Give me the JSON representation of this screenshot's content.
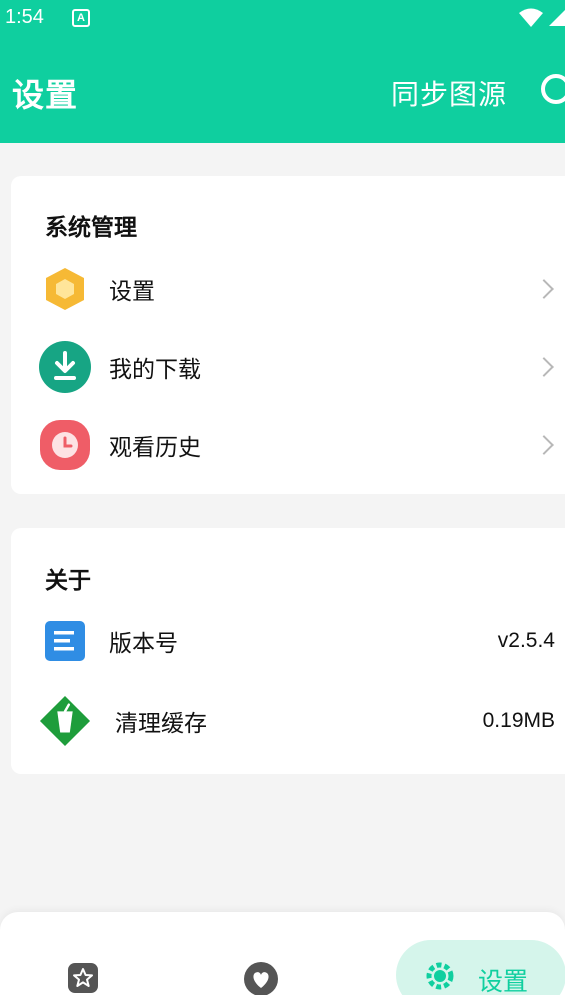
{
  "status": {
    "time": "1:54",
    "badge": "A"
  },
  "header": {
    "title": "设置",
    "sync_label": "同步图源"
  },
  "system_section": {
    "title": "系统管理",
    "items": [
      {
        "label": "设置",
        "icon": "hexagon-settings-icon"
      },
      {
        "label": "我的下载",
        "icon": "download-icon"
      },
      {
        "label": "观看历史",
        "icon": "clock-history-icon"
      }
    ]
  },
  "about_section": {
    "title": "关于",
    "items": [
      {
        "label": "版本号",
        "value": "v2.5.4",
        "icon": "document-icon"
      },
      {
        "label": "清理缓存",
        "value": "0.19MB",
        "icon": "cup-cache-icon"
      }
    ]
  },
  "bottom_nav": {
    "settings_label": "设置"
  },
  "colors": {
    "accent": "#0fcf9f",
    "accent_light": "#d5f5eb"
  }
}
